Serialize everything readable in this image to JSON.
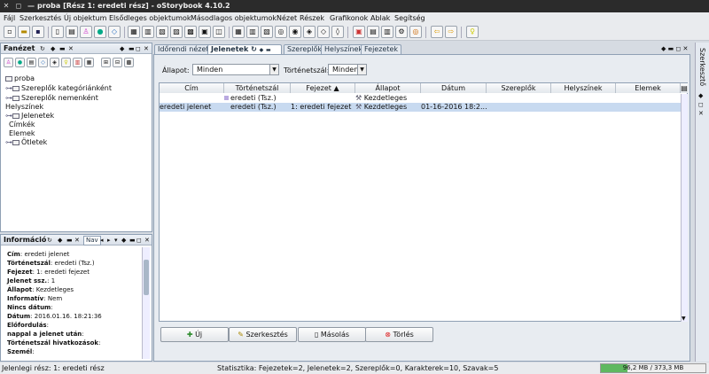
{
  "window": {
    "title": "proba [Rész 1: eredeti rész] - oStorybook 4.10.2"
  },
  "menu": [
    "Fájl",
    "Szerkesztés",
    "Új objektum",
    "Elsődleges objektumok",
    "Másodlagos objektumok",
    "Nézet",
    "Részek",
    "Grafikonok",
    "Ablak",
    "Segítség"
  ],
  "navigator": {
    "title": "Fanézet",
    "tree": [
      "proba",
      "Szereplők kategóriánként",
      "Szereplők nemenként",
      "Helyszínek",
      "Jelenetek",
      "Címkék",
      "Elemek",
      "Ötletek"
    ]
  },
  "info": {
    "title": "Információ",
    "tab2": "Nav",
    "lines": [
      {
        "label": "Cím",
        "value": "eredeti jelenet"
      },
      {
        "label": "Történetszál",
        "value": "eredeti (Tsz.)"
      },
      {
        "label": "Fejezet",
        "value": "1: eredeti fejezet"
      },
      {
        "label": "Jelenet ssz.",
        "value": "1"
      },
      {
        "label": "Állapot",
        "value": "Kezdetleges"
      },
      {
        "label": "Informatív",
        "value": "Nem"
      },
      {
        "label": "Nincs dátum",
        "value": ""
      },
      {
        "label": "Dátum",
        "value": "2016.01.16. 18:21:36"
      },
      {
        "label": "Előfordulás",
        "value": ""
      },
      {
        "label": "nappal a jelenet után",
        "value": ""
      },
      {
        "label": "Történetszál hivatkozások",
        "value": ""
      },
      {
        "label": "Személ",
        "value": ""
      }
    ]
  },
  "tabs": [
    "Időrendi nézet",
    "Jelenetek",
    "Szereplők",
    "Helyszínek",
    "Fejezetek"
  ],
  "filters": {
    "state_label": "Állapot:",
    "state_value": "Minden",
    "strand_label": "Történetszál:",
    "strand_value": "Minden"
  },
  "table": {
    "columns": [
      "Cím",
      "Történetszál",
      "Fejezet ▲",
      "Állapot",
      "Dátum",
      "Szereplők",
      "Helyszínek",
      "Elemek"
    ],
    "rows": [
      {
        "title": "",
        "strand": "eredeti (Tsz.)",
        "chapter": "",
        "state": "Kezdetleges",
        "date": ""
      },
      {
        "title": "eredeti jelenet",
        "strand": "eredeti (Tsz.)",
        "chapter": "1: eredeti fejezet",
        "state": "Kezdetleges",
        "date": "01-16-2016 18:2..."
      }
    ]
  },
  "buttons": {
    "new": "Új",
    "edit": "Szerkesztés",
    "copy": "Másolás",
    "delete": "Törlés"
  },
  "status": {
    "left": "Jelenlegi rész: 1: eredeti rész",
    "stats": "Statisztika: Fejezetek=2, Jelenetek=2, Szereplők=0, Karakterek=10, Szavak=5",
    "memory": "96,2 MB / 373,3 MB",
    "memory_fraction": 0.258
  },
  "right_panel": {
    "label": "Szerkesztő"
  },
  "colors": {
    "accent": "#4a90d9",
    "selected_row": "#c8daf0",
    "memory_bar": "#5fb860"
  }
}
